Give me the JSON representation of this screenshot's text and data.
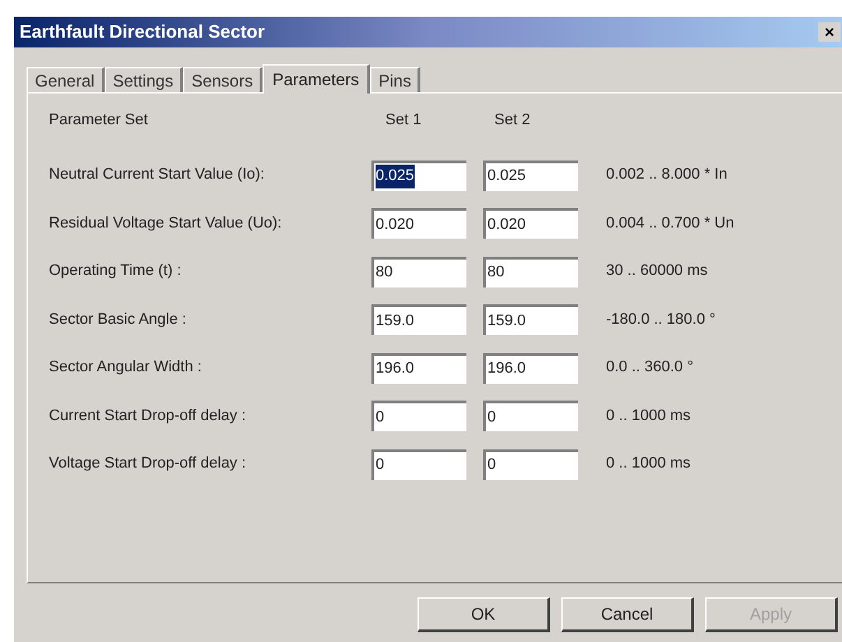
{
  "window": {
    "title": "Earthfault Directional Sector",
    "close": "×"
  },
  "tabs": [
    {
      "label": "General",
      "selected": false
    },
    {
      "label": "Settings",
      "selected": false
    },
    {
      "label": "Sensors",
      "selected": false
    },
    {
      "label": "Parameters",
      "selected": true
    },
    {
      "label": "Pins",
      "selected": false
    }
  ],
  "header": {
    "label": "Parameter Set",
    "set_1": "Set 1",
    "set_2": "Set 2"
  },
  "parameters": [
    {
      "label": "Neutral Current Start Value (Io):",
      "set_1": {
        "value": "0.025",
        "highlighted": true
      },
      "set_2": {
        "value": "0.025",
        "highlighted": false
      },
      "range": "0.002 .. 8.000  * In"
    },
    {
      "label": "Residual Voltage Start Value (Uo):",
      "set_1": {
        "value": "0.020",
        "highlighted": false
      },
      "set_2": {
        "value": "0.020",
        "highlighted": false
      },
      "range": "0.004 .. 0.700 * Un"
    },
    {
      "label": "Operating Time (t) :",
      "set_1": {
        "value": "80",
        "highlighted": false
      },
      "set_2": {
        "value": "80",
        "highlighted": false
      },
      "range": "30 .. 60000 ms"
    },
    {
      "label": "Sector Basic Angle :",
      "set_1": {
        "value": "159.0",
        "highlighted": false
      },
      "set_2": {
        "value": "159.0",
        "highlighted": false
      },
      "range": "-180.0 .. 180.0 °"
    },
    {
      "label": "Sector Angular Width :",
      "set_1": {
        "value": "196.0",
        "highlighted": false
      },
      "set_2": {
        "value": "196.0",
        "highlighted": false
      },
      "range": "0.0 .. 360.0 °"
    },
    {
      "label": "Current Start Drop-off delay :",
      "set_1": {
        "value": "0",
        "highlighted": false
      },
      "set_2": {
        "value": "0",
        "highlighted": false
      },
      "range": "0 .. 1000 ms"
    },
    {
      "label": "Voltage Start Drop-off delay :",
      "set_1": {
        "value": "0",
        "highlighted": false
      },
      "set_2": {
        "value": "0",
        "highlighted": false
      },
      "range": "0 .. 1000 ms"
    }
  ],
  "buttons": [
    {
      "label": "OK",
      "disabled": false
    },
    {
      "label": "Cancel",
      "disabled": false
    },
    {
      "label": "Apply",
      "disabled": true
    }
  ]
}
